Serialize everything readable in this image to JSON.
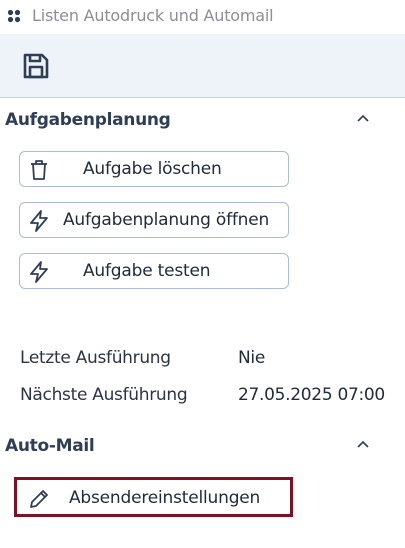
{
  "window": {
    "title": "Listen Autodruck und Automail",
    "icon": "app-grid-icon"
  },
  "toolbar": {
    "save_icon": "save-icon"
  },
  "sections": {
    "scheduling": {
      "title": "Aufgabenplanung",
      "collapse_icon": "chevron-up-icon",
      "buttons": {
        "delete": {
          "label": "Aufgabe löschen",
          "icon": "trash-icon"
        },
        "open": {
          "label": "Aufgabenplanung öffnen",
          "icon": "lightning-icon"
        },
        "test": {
          "label": "Aufgabe testen",
          "icon": "lightning-icon"
        }
      },
      "info": {
        "last": {
          "label": "Letzte Ausführung",
          "value": "Nie"
        },
        "next": {
          "label": "Nächste Ausführung",
          "value": "27.05.2025 07:00"
        }
      }
    },
    "automail": {
      "title": "Auto-Mail",
      "collapse_icon": "chevron-up-icon",
      "buttons": {
        "sender": {
          "label": "Absendereinstellungen",
          "icon": "pencil-icon"
        }
      }
    }
  },
  "colors": {
    "toolbar_bg": "#eef3fa",
    "section_title": "#2f3e55",
    "button_border": "#a9bdd4",
    "focus_highlight": "#7a1424"
  }
}
